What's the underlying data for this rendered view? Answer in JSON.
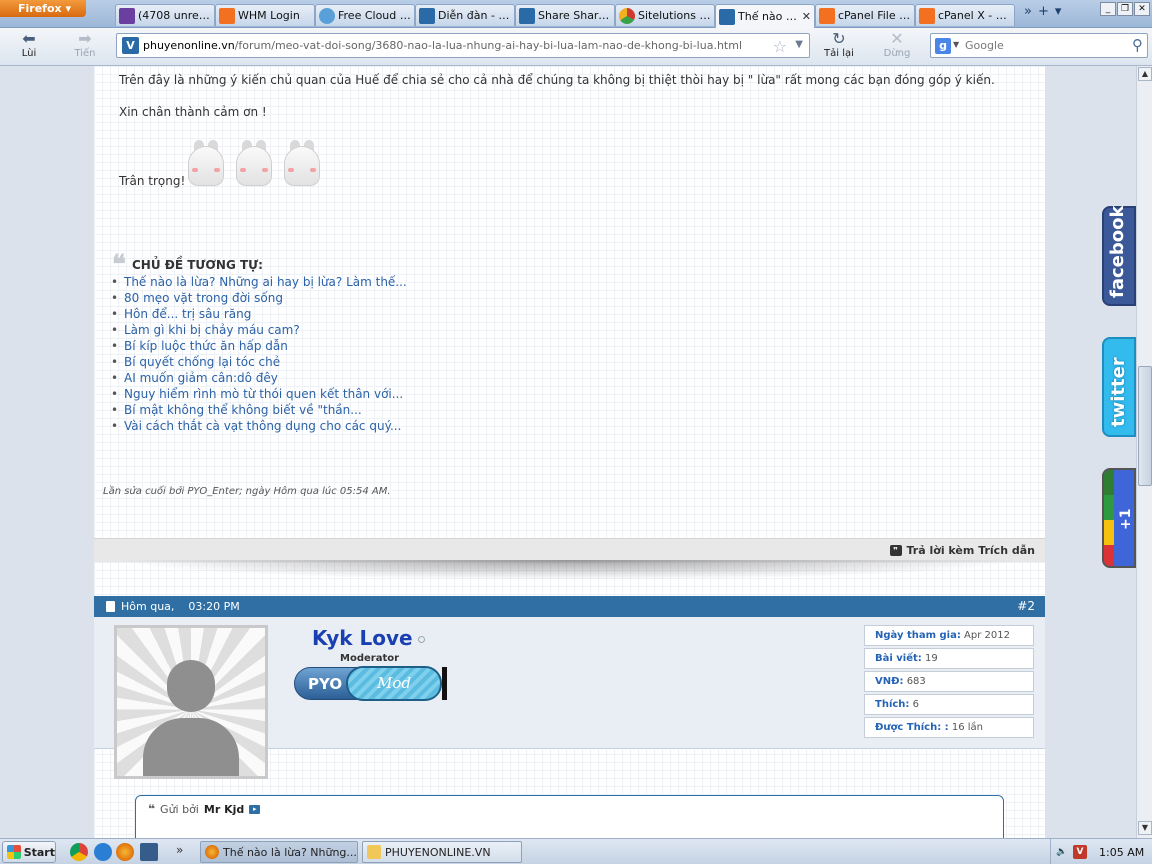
{
  "browser": {
    "app_button": "Firefox",
    "tabs": [
      {
        "label": "(4708 unread) ...",
        "icon": "yahoo-mail-icon",
        "color": "#6a3fa0",
        "active": false
      },
      {
        "label": "WHM Login",
        "icon": "cpanel-icon",
        "color": "#f37021",
        "active": false
      },
      {
        "label": "Free Cloud S...",
        "icon": "cloud-icon",
        "color": "#5aa0d8",
        "active": false
      },
      {
        "label": "Diễn đàn - C...",
        "icon": "forum-icon",
        "color": "#2a6aa6",
        "active": false
      },
      {
        "label": "Share Share ...",
        "icon": "forum-icon",
        "color": "#2a6aa6",
        "active": false
      },
      {
        "label": "Sitelutions - ...",
        "icon": "sitelutions-icon",
        "color": "#d03a2a",
        "active": false
      },
      {
        "label": "Thế nào l...",
        "icon": "pyo-icon",
        "color": "#2a6aa6",
        "active": true
      },
      {
        "label": "cPanel File M...",
        "icon": "cpanel-icon",
        "color": "#f37021",
        "active": false
      },
      {
        "label": "cPanel X - Fil...",
        "icon": "cpanel-icon",
        "color": "#f37021",
        "active": false
      }
    ],
    "nav": {
      "back": "Lùi",
      "forward": "Tiến",
      "reload": "Tải lại",
      "stop": "Dừng"
    },
    "url_host": "phuyenonline.vn",
    "url_path": "/forum/meo-vat-doi-song/3680-nao-la-lua-nhung-ai-hay-bi-lua-lam-nao-de-khong-bi-lua.html",
    "search_placeholder": "Google"
  },
  "post": {
    "closing_text": "Trên đây là những ý kiến chủ quan của Huế để chia sẻ cho cả nhà để chúng ta không bị thiệt thòi hay bị \" lừa\" rất mong các bạn đóng góp ý kiến.",
    "thanks": "Xin chân thành cảm ơn !",
    "signoff": "Trân trọng!",
    "related_title": "CHỦ ĐỀ TƯƠNG TỰ:",
    "related": [
      "Thế nào là lừa? Những ai hay bị lừa? Làm thế...",
      "80 mẹo vặt trong đời sống",
      "Hôn để... trị sâu răng",
      "Làm gì khi bị chảy máu cam?",
      "Bí kíp luộc thức ăn hấp dẫn",
      "Bí quyết chống lại tóc chẻ",
      "AI muốn giảm cân:dô đêy",
      "Nguy hiểm rình mò từ thói quen kết thân với...",
      "Bí mật không thể không biết về \"thần...",
      "Vài cách thắt cà vạt thông dụng cho các quý..."
    ],
    "edit_note": "Lần sửa cuối bởi PYO_Enter; ngày Hôm qua lúc 05:54 AM.",
    "reply_quote": "Trả lời kèm Trích dẫn"
  },
  "next_post": {
    "date": "Hôm qua,",
    "time": "03:20 PM",
    "number": "#2",
    "username": "Kyk Love",
    "usertitle": "Moderator",
    "rank_left": "PYO",
    "rank_right": "Mod",
    "stats": [
      {
        "label": "Ngày tham gia:",
        "value": "Apr 2012"
      },
      {
        "label": "Bài viết:",
        "value": "19"
      },
      {
        "label": "VNĐ:",
        "value": "683"
      },
      {
        "label": "Thích:",
        "value": "6"
      },
      {
        "label": "Được Thích: :",
        "value": "16 lần"
      }
    ],
    "sent_by_label": "Gửi bởi",
    "sent_by_user": "Mr Kjd"
  },
  "social": {
    "facebook": "facebook",
    "twitter": "twitter",
    "gplus": "+1"
  },
  "taskbar": {
    "start": "Start",
    "tasks": [
      {
        "label": "Thế nào là lừa? Những...",
        "icon": "firefox-icon"
      },
      {
        "label": "PHUYENONLINE.VN",
        "icon": "folder-icon"
      }
    ],
    "clock": "1:05 AM"
  }
}
